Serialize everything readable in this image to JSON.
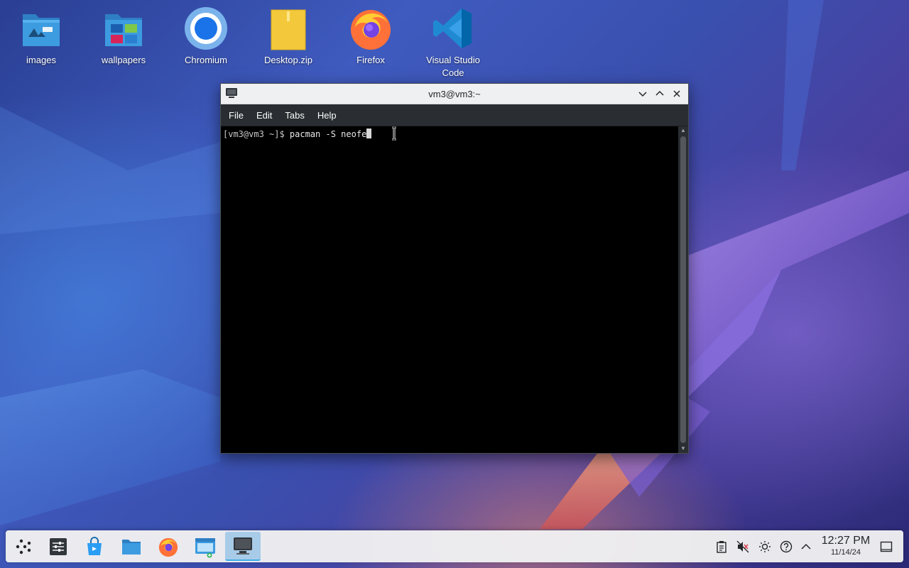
{
  "desktop": {
    "icons": [
      {
        "label": "images",
        "icon": "folder-images-icon"
      },
      {
        "label": "wallpapers",
        "icon": "folder-wallpapers-icon"
      },
      {
        "label": "Chromium",
        "icon": "chromium-icon"
      },
      {
        "label": "Desktop.zip",
        "icon": "zip-archive-icon"
      },
      {
        "label": "Firefox",
        "icon": "firefox-icon"
      },
      {
        "label": "Visual Studio\nCode",
        "icon": "vscode-icon"
      }
    ]
  },
  "window": {
    "title": "vm3@vm3:~",
    "menu": [
      "File",
      "Edit",
      "Tabs",
      "Help"
    ],
    "terminal": {
      "prompt": "[vm3@vm3 ~]$ ",
      "command": "pacman -S neofe"
    }
  },
  "taskbar": {
    "launchers": [
      {
        "icon": "application-launcher-icon"
      },
      {
        "icon": "system-settings-icon"
      },
      {
        "icon": "discover-store-icon"
      },
      {
        "icon": "file-manager-icon"
      },
      {
        "icon": "firefox-icon"
      },
      {
        "icon": "dolphin-folder-icon"
      },
      {
        "icon": "terminal-icon",
        "active": true
      }
    ],
    "tray": [
      "clipboard-icon",
      "volume-muted-icon",
      "brightness-icon",
      "help-icon",
      "expand-tray-icon"
    ],
    "clock": {
      "time": "12:27 PM",
      "date": "11/14/24"
    },
    "show_desktop_icon": "show-desktop-icon"
  },
  "colors": {
    "panel": "#eff0f1",
    "active_task": "#a8cbe8",
    "accent": "#3daee9",
    "menubar": "#2a2e32"
  }
}
